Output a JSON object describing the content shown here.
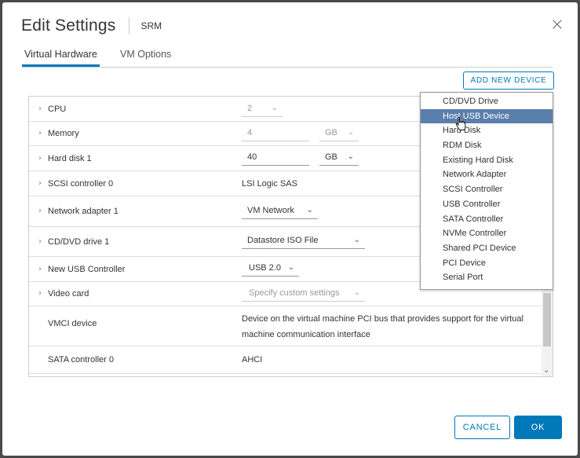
{
  "dialog": {
    "title": "Edit Settings",
    "subtitle": "SRM",
    "close_icon": "close-icon"
  },
  "tabs": [
    {
      "label": "Virtual Hardware",
      "active": true
    },
    {
      "label": "VM Options",
      "active": false
    }
  ],
  "add_button": "ADD NEW DEVICE",
  "hardware": {
    "cpu": {
      "label": "CPU",
      "value": "2"
    },
    "memory": {
      "label": "Memory",
      "value": "4",
      "unit": "GB"
    },
    "disk": {
      "label": "Hard disk 1",
      "value": "40",
      "unit": "GB"
    },
    "scsi": {
      "label": "SCSI controller 0",
      "value": "LSI Logic SAS"
    },
    "network": {
      "label": "Network adapter 1",
      "value": "VM Network"
    },
    "cdvd": {
      "label": "CD/DVD drive 1",
      "value": "Datastore ISO File"
    },
    "usb": {
      "label": "New USB Controller",
      "value": "USB 2.0"
    },
    "video": {
      "label": "Video card",
      "value": "Specify custom settings"
    },
    "vmci": {
      "label": "VMCI device",
      "value": "Device on the virtual machine PCI bus that provides support for the virtual machine communication interface"
    },
    "sata": {
      "label": "SATA controller 0",
      "value": "AHCI"
    }
  },
  "dropdown": {
    "selected": "Host USB Device",
    "items": [
      "CD/DVD Drive",
      "Host USB Device",
      "Hard Disk",
      "RDM Disk",
      "Existing Hard Disk",
      "Network Adapter",
      "SCSI Controller",
      "USB Controller",
      "SATA Controller",
      "NVMe Controller",
      "Shared PCI Device",
      "PCI Device",
      "Serial Port"
    ]
  },
  "buttons": {
    "cancel": "CANCEL",
    "ok": "OK"
  },
  "colors": {
    "accent": "#0079b8",
    "menu_highlight": "#5b7fab",
    "backdrop": "#4a4a4a"
  }
}
